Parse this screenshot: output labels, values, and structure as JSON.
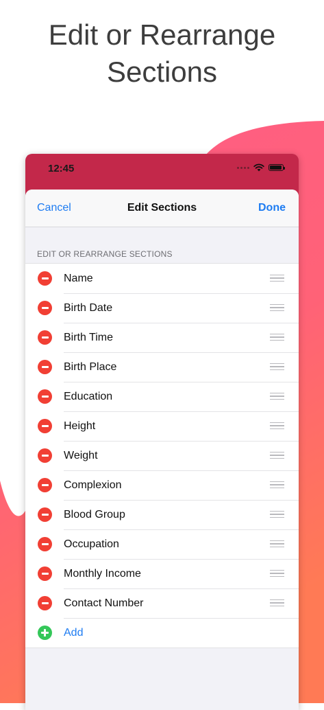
{
  "headline": {
    "line1": "Edit or Rearrange",
    "line2": "Sections"
  },
  "colors": {
    "accent": "#1e7cf2",
    "delete": "#f13f34",
    "add": "#34c759",
    "header_bar": "#c3284a"
  },
  "status_bar": {
    "time": "12:45",
    "icons": [
      "signal-dots-icon",
      "wifi-icon",
      "battery-icon"
    ]
  },
  "nav": {
    "cancel": "Cancel",
    "title": "Edit Sections",
    "done": "Done"
  },
  "section_header": "EDIT OR REARRANGE SECTIONS",
  "sections": [
    {
      "label": "Name"
    },
    {
      "label": "Birth Date"
    },
    {
      "label": "Birth Time"
    },
    {
      "label": "Birth Place"
    },
    {
      "label": "Education"
    },
    {
      "label": "Height"
    },
    {
      "label": "Weight"
    },
    {
      "label": "Complexion"
    },
    {
      "label": "Blood Group"
    },
    {
      "label": "Occupation"
    },
    {
      "label": "Monthly Income"
    },
    {
      "label": "Contact Number"
    }
  ],
  "add_label": "Add"
}
